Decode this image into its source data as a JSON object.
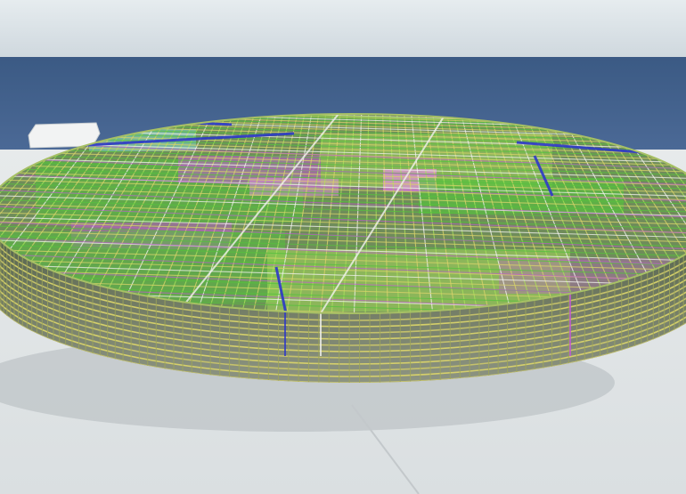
{
  "scene": {
    "subject": "reinforcement-cage-render",
    "colors": {
      "sky_top": "#e4eaee",
      "sky_horizon": "#cfd8de",
      "sea_far": "#3d5c86",
      "sea_near": "#4a6794",
      "ground": "#dfe3e5",
      "ground_shadow": "#aeb6bb",
      "wall_dark": "#2e3a35",
      "rebar_yellow": "#d9d36a",
      "rebar_green": "#56c13e",
      "rebar_lime": "#a9e05a",
      "rebar_magenta": "#c25ad2",
      "rebar_pink": "#e58fe0",
      "rebar_blue": "#2d38c8",
      "rebar_cyan": "#7fe0d8",
      "rebar_white": "#f2f2ee"
    }
  }
}
